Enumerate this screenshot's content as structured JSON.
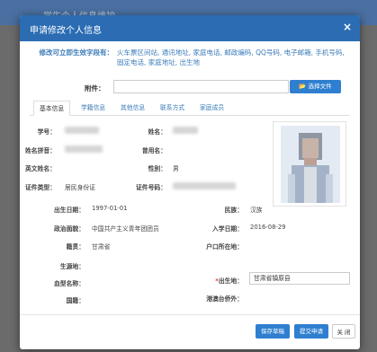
{
  "background": {
    "title": "学生个人信息维护"
  },
  "modal": {
    "title": "申请修改个人信息",
    "close_symbol": "×"
  },
  "editable": {
    "label": "修改可立即生效字段有：",
    "value": "火车票区间站, 通讯地址, 家庭电话, 邮政编码, QQ号码, 电子邮箱, 手机号码, 固定电话, 家庭地址, 出生地"
  },
  "attachment": {
    "label": "附件：",
    "button_label": "选择文件",
    "input_value": ""
  },
  "tabs": [
    {
      "label": "基本信息",
      "active": true
    },
    {
      "label": "学籍信息"
    },
    {
      "label": "其他信息"
    },
    {
      "label": "联系方式"
    },
    {
      "label": "家庭成员"
    }
  ],
  "fields": {
    "student_id": {
      "label": "学号："
    },
    "name": {
      "label": "姓名："
    },
    "name_pinyin": {
      "label": "姓名拼音："
    },
    "former_name": {
      "label": "曾用名："
    },
    "english_name": {
      "label": "英文姓名："
    },
    "gender": {
      "label": "性别：",
      "value": "男"
    },
    "id_type": {
      "label": "证件类型：",
      "value": "居民身份证"
    },
    "id_number": {
      "label": "证件号码："
    },
    "birth_date": {
      "label": "出生日期：",
      "value": "1997-01-01"
    },
    "ethnicity": {
      "label": "民族：",
      "value": "汉族"
    },
    "political_status": {
      "label": "政治面貌：",
      "value": "中国共产主义青年团团员"
    },
    "enrollment_date": {
      "label": "入学日期：",
      "value": "2016-08-29"
    },
    "native_place": {
      "label": "籍贯：",
      "value": "甘肃省"
    },
    "household_location": {
      "label": "户口所在地："
    },
    "origin": {
      "label": "生源地："
    },
    "birthplace": {
      "label": "出生地：",
      "required_mark": "*",
      "value": "甘肃省镇原县"
    },
    "blood_type": {
      "label": "血型名称："
    },
    "hk_macau_tw": {
      "label": "港澳台侨外："
    },
    "nationality": {
      "label": "国籍："
    }
  },
  "footer": {
    "save_draft": "保存草稿",
    "submit": "提交申请",
    "close": "关 闭"
  },
  "colors": {
    "header_blue": "#2b6cb3",
    "link_blue": "#3a7bb8",
    "button_blue": "#2f7fd0"
  }
}
